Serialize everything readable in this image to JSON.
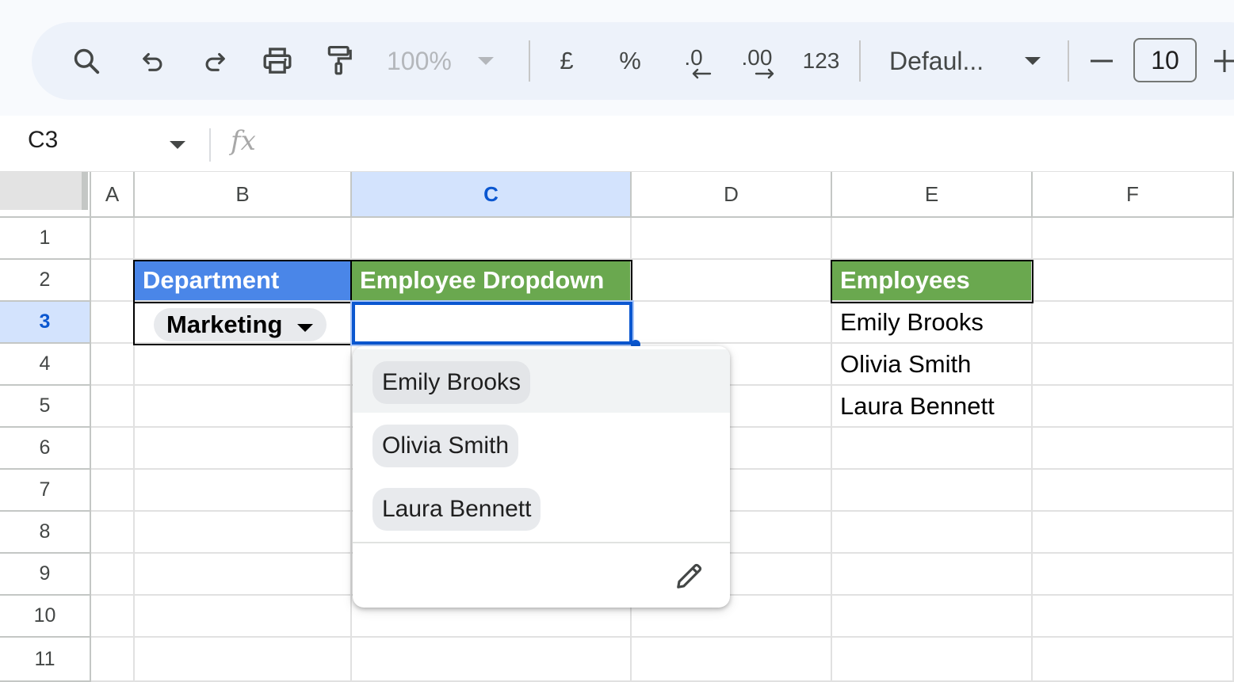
{
  "toolbar": {
    "zoom": "100%",
    "currency_label": "£",
    "percent_label": "%",
    "decrease_decimal_label": ".0",
    "increase_decimal_label": ".00",
    "more_formats_label": "123",
    "font_name": "Defaul...",
    "font_size": "10",
    "icons": [
      "search-icon",
      "undo-icon",
      "redo-icon",
      "print-icon",
      "paint-format-icon",
      "chevron-down-icon",
      "minus-icon",
      "plus-icon"
    ]
  },
  "formula_bar": {
    "name_box": "C3",
    "fx_label": "fx",
    "formula": ""
  },
  "grid": {
    "columns": [
      "A",
      "B",
      "C",
      "D",
      "E",
      "F"
    ],
    "selected_column": "C",
    "rows": [
      "1",
      "2",
      "3",
      "4",
      "5",
      "6",
      "7",
      "8",
      "9",
      "10",
      "11"
    ],
    "selected_row": "3",
    "cells": {
      "B2": "Department",
      "C2": "Employee Dropdown",
      "B3": "Marketing",
      "C3": "",
      "E2": "Employees",
      "E3": "Emily Brooks",
      "E4": "Olivia Smith",
      "E5": "Laura Bennett"
    },
    "colors": {
      "header_blue": "#4a86e8",
      "header_green": "#6aa84f",
      "selection_blue": "#0b57d0",
      "selected_header_bg": "#d3e3fd"
    }
  },
  "dropdown": {
    "options": [
      "Emily Brooks",
      "Olivia Smith",
      "Laura Bennett"
    ],
    "highlighted_index": 0,
    "edit_icon": "pencil-icon"
  }
}
